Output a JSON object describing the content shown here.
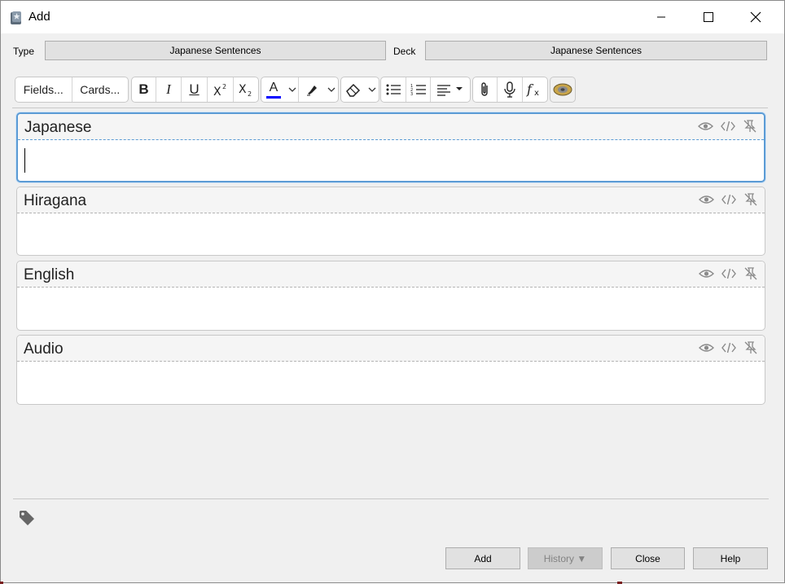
{
  "window": {
    "title": "Add"
  },
  "note_type": {
    "label": "Type",
    "value": "Japanese Sentences"
  },
  "deck": {
    "label": "Deck",
    "value": "Japanese Sentences"
  },
  "toolbar": {
    "fields_label": "Fields...",
    "cards_label": "Cards...",
    "bold": "B",
    "italic": "I",
    "underline": "U",
    "text_color": "A",
    "text_color_value": "#0000ff"
  },
  "fields": [
    {
      "name": "Japanese",
      "value": ""
    },
    {
      "name": "Hiragana",
      "value": ""
    },
    {
      "name": "English",
      "value": ""
    },
    {
      "name": "Audio",
      "value": ""
    }
  ],
  "buttons": {
    "add": "Add",
    "history": "History ▼",
    "close": "Close",
    "help": "Help"
  },
  "colors": {
    "focus_border": "#5b9bd5",
    "button_bg": "#e1e1e1"
  }
}
